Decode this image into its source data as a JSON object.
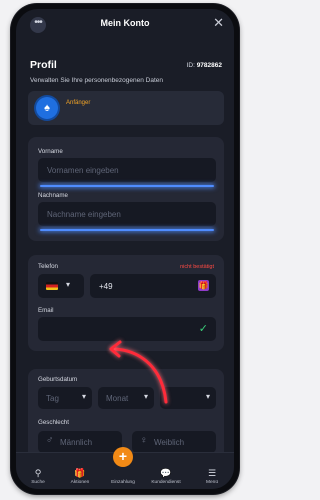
{
  "header": {
    "title": "Mein Konto",
    "more_icon": "more-dots-icon",
    "close_icon": "close-icon"
  },
  "profile": {
    "heading": "Profil",
    "id_label": "ID:",
    "id_value": "9782862",
    "subtitle": "Verwalten Sie Ihre personenbezogenen Daten",
    "level": "Anfänger"
  },
  "name_section": {
    "first_label": "Vorname",
    "first_placeholder": "Vornamen eingeben",
    "last_label": "Nachname",
    "last_placeholder": "Nachname eingeben"
  },
  "contact_section": {
    "phone_label": "Telefon",
    "phone_status": "nicht bestätigt",
    "phone_prefix": "+49",
    "email_label": "Email"
  },
  "details_section": {
    "birth_label": "Geburtsdatum",
    "day_placeholder": "Tag",
    "month_placeholder": "Monat",
    "gender_label": "Geschlecht",
    "male": "Männlich",
    "female": "Weiblich"
  },
  "bottom_nav": [
    {
      "label": "Suche",
      "icon": "search-icon"
    },
    {
      "label": "Aktionen",
      "icon": "gift-icon"
    },
    {
      "label": "Einzahlung",
      "icon": "plus-icon"
    },
    {
      "label": "Kundendienst",
      "icon": "chat-icon"
    },
    {
      "label": "Menü",
      "icon": "menu-icon"
    }
  ],
  "colors": {
    "accent_blue": "#4f8cff",
    "accent_orange": "#f28a16",
    "warning_red": "#ff4a43",
    "success_green": "#3ad07a",
    "annotation_arrow": "#ff2b3a"
  }
}
